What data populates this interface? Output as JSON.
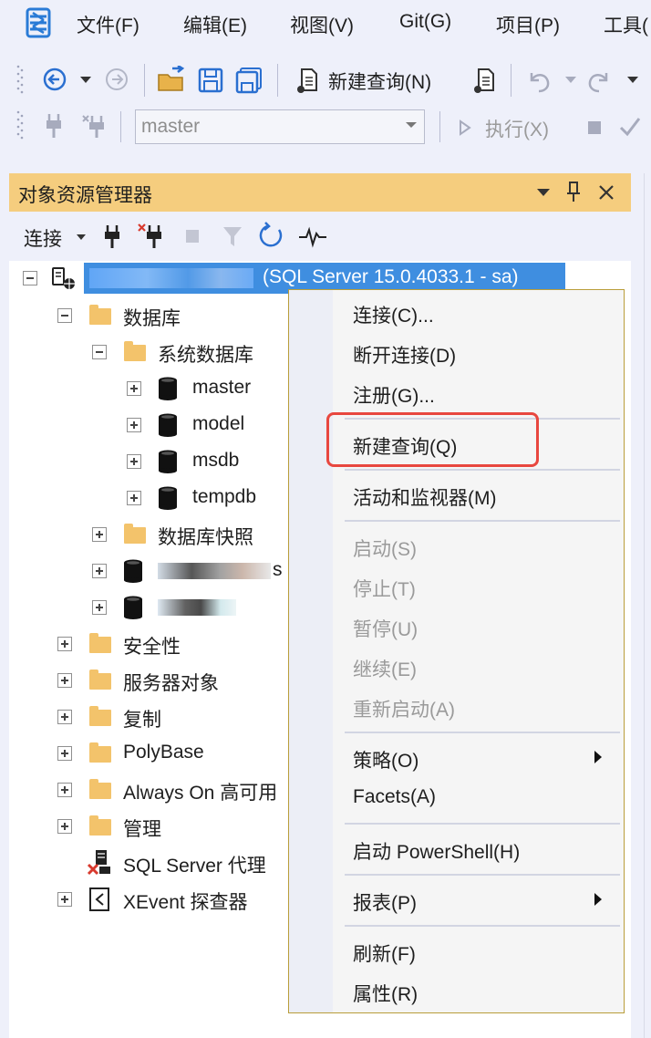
{
  "menubar": {
    "items": [
      "文件(F)",
      "编辑(E)",
      "视图(V)",
      "Git(G)",
      "项目(P)",
      "工具("
    ]
  },
  "toolbar": {
    "new_query": "新建查询(N)",
    "database_selector": "master",
    "execute": "执行(X)"
  },
  "explorer": {
    "title": "对象资源管理器",
    "connect_label": "连接",
    "server_label": "(SQL Server 15.0.4033.1 - sa)",
    "tree": {
      "databases": "数据库",
      "system_databases": "系统数据库",
      "master": "master",
      "model": "model",
      "msdb": "msdb",
      "tempdb": "tempdb",
      "snapshots": "数据库快照",
      "user_db1_suffix": "s",
      "security": "安全性",
      "server_objects": "服务器对象",
      "replication": "复制",
      "polybase": "PolyBase",
      "always_on": "Always On 高可用",
      "management": "管理",
      "sql_agent": "SQL Server 代理",
      "xevent": "XEvent 探查器"
    }
  },
  "context_menu": {
    "connect": "连接(C)...",
    "disconnect": "断开连接(D)",
    "register": "注册(G)...",
    "new_query": "新建查询(Q)",
    "activity_monitor": "活动和监视器(M)",
    "start": "启动(S)",
    "stop": "停止(T)",
    "pause": "暂停(U)",
    "resume": "继续(E)",
    "restart": "重新启动(A)",
    "policies": "策略(O)",
    "facets": "Facets(A)",
    "powershell": "启动 PowerShell(H)",
    "reports": "报表(P)",
    "refresh": "刷新(F)",
    "properties": "属性(R)"
  },
  "colors": {
    "panel_title": "#f5cd7e",
    "selection": "#3f8ee0",
    "highlight_box": "#e8473f",
    "menu_border": "#b99d3a"
  }
}
